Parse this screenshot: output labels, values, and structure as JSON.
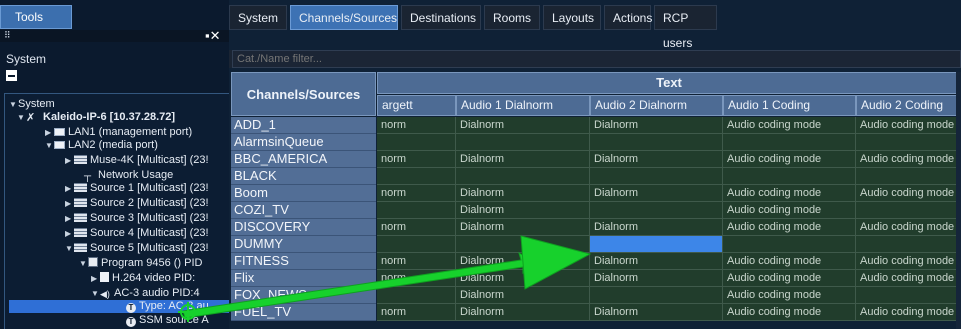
{
  "left_panel": {
    "tools_tab": "Tools",
    "system_label": "System",
    "tree": [
      {
        "label": "System",
        "arrow": "▼",
        "icon": "none"
      },
      {
        "label": "Kaleido-IP-6 [10.37.28.72]",
        "arrow": "▼",
        "icon": "device"
      },
      {
        "label": "LAN1 (management port)",
        "arrow": "▶",
        "icon": "pc"
      },
      {
        "label": "LAN2 (media port)",
        "arrow": "▼",
        "icon": "pc"
      },
      {
        "label": "Muse-4K [Multicast] (23!",
        "arrow": "▶",
        "icon": "stream"
      },
      {
        "label": "Network Usage",
        "arrow": "",
        "icon": "net"
      },
      {
        "label": "Source 1 [Multicast] (23!",
        "arrow": "▶",
        "icon": "stream"
      },
      {
        "label": "Source 2 [Multicast] (23!",
        "arrow": "▶",
        "icon": "stream"
      },
      {
        "label": "Source 3 [Multicast] (23!",
        "arrow": "▶",
        "icon": "stream"
      },
      {
        "label": "Source 4 [Multicast] (23!",
        "arrow": "▶",
        "icon": "stream"
      },
      {
        "label": "Source 5 [Multicast] (23!",
        "arrow": "▼",
        "icon": "stream"
      },
      {
        "label": "Program 9456 () PID",
        "arrow": "▼",
        "icon": "program"
      },
      {
        "label": "H.264 video PID:",
        "arrow": "▶",
        "icon": "video"
      },
      {
        "label": "AC-3 audio PID:4",
        "arrow": "▼",
        "icon": "audio"
      },
      {
        "label": "Type: AC-3 au",
        "arrow": "",
        "icon": "t"
      },
      {
        "label": "SSM source A",
        "arrow": "",
        "icon": "t"
      }
    ]
  },
  "tabs": [
    "System",
    "Channels/Sources",
    "Destinations",
    "Rooms",
    "Layouts",
    "Actions",
    "RCP users"
  ],
  "active_tab": "Channels/Sources",
  "filter": {
    "placeholder": "Cat./Name filter..."
  },
  "grid": {
    "name_header": "Channels/Sources",
    "group_header": "Text",
    "columns": [
      "argett",
      "Audio 1 Dialnorm",
      "Audio 2 Dialnorm",
      "Audio 1 Coding",
      "Audio 2 Coding"
    ],
    "rows": [
      {
        "name": "ADD_1",
        "cells": [
          "norm",
          "Dialnorm",
          "Dialnorm",
          "Audio coding mode",
          "Audio coding mode"
        ]
      },
      {
        "name": "AlarmsinQueue",
        "cells": [
          "",
          "",
          "",
          "",
          ""
        ]
      },
      {
        "name": "BBC_AMERICA",
        "cells": [
          "norm",
          "Dialnorm",
          "Dialnorm",
          "Audio coding mode",
          "Audio coding mode"
        ]
      },
      {
        "name": "BLACK",
        "cells": [
          "",
          "",
          "",
          "",
          ""
        ]
      },
      {
        "name": "Boom",
        "cells": [
          "norm",
          "Dialnorm",
          "Dialnorm",
          "Audio coding mode",
          "Audio coding mode"
        ]
      },
      {
        "name": "COZI_TV",
        "cells": [
          "",
          "Dialnorm",
          "",
          "Audio coding mode",
          ""
        ]
      },
      {
        "name": "DISCOVERY",
        "cells": [
          "norm",
          "Dialnorm",
          "Dialnorm",
          "Audio coding mode",
          "Audio coding mode"
        ]
      },
      {
        "name": "DUMMY",
        "cells": [
          "",
          "",
          "",
          "",
          ""
        ]
      },
      {
        "name": "FITNESS",
        "cells": [
          "norm",
          "Dialnorm",
          "Dialnorm",
          "Audio coding mode",
          "Audio coding mode"
        ]
      },
      {
        "name": "Flix",
        "cells": [
          "norm",
          "Dialnorm",
          "Dialnorm",
          "Audio coding mode",
          "Audio coding mode"
        ]
      },
      {
        "name": "FOX_NEWS",
        "cells": [
          "",
          "Dialnorm",
          "",
          "Audio coding mode",
          ""
        ]
      },
      {
        "name": "FUEL_TV",
        "cells": [
          "norm",
          "Dialnorm",
          "Dialnorm",
          "Audio coding mode",
          "Audio coding mode"
        ]
      }
    ],
    "highlight_row": "DUMMY",
    "highlight_column": "Audio 2 Dialnorm"
  },
  "colors": {
    "accent": "#3d72b4",
    "highlight": "#3d86e8",
    "drag_arrow": "#17d12c",
    "cell_bg": "#213d2c"
  }
}
